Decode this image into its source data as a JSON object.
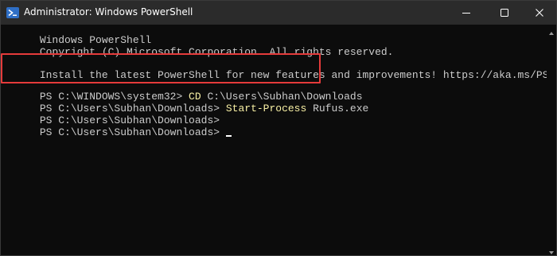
{
  "window": {
    "title": "Administrator: Windows PowerShell"
  },
  "console": {
    "lines": [
      {
        "text": "Windows PowerShell"
      },
      {
        "text": "Copyright (C) Microsoft Corporation. All rights reserved."
      },
      {
        "text": ""
      },
      {
        "text": "Install the latest PowerShell for new features and improvements! https://aka.ms/PSWindows"
      },
      {
        "text": ""
      },
      {
        "prompt": "PS C:\\WINDOWS\\system32> ",
        "command": "CD",
        "args": " C:\\Users\\Subhan\\Downloads"
      },
      {
        "prompt": "PS C:\\Users\\Subhan\\Downloads> ",
        "command": "Start-Process",
        "args": " Rufus.exe"
      },
      {
        "prompt": "PS C:\\Users\\Subhan\\Downloads>"
      },
      {
        "prompt": "PS C:\\Users\\Subhan\\Downloads>"
      }
    ]
  },
  "colors": {
    "background": "#0c0c0c",
    "text": "#cccccc",
    "command": "#f9f1a5",
    "highlight_border": "#e53b3b",
    "titlebar": "#2b2b2b"
  },
  "icons": {
    "app": "powershell-icon",
    "minimize": "minimize-icon",
    "maximize": "maximize-icon",
    "close": "close-icon",
    "scroll_up": "scroll-up-arrow-icon",
    "scroll_down": "scroll-down-arrow-icon"
  }
}
